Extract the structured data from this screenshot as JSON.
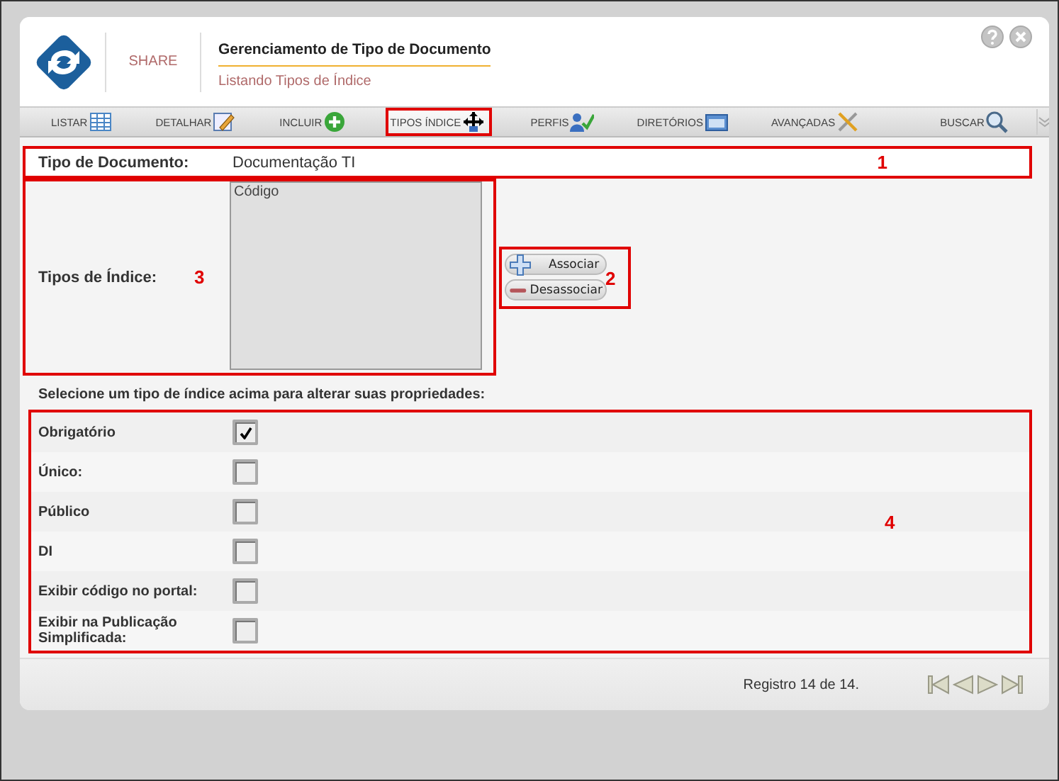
{
  "header": {
    "logo_text": "SHARE",
    "title": "Gerenciamento de Tipo de Documento",
    "subtitle": "Listando Tipos de Índice"
  },
  "tabs": [
    {
      "label": "LISTAR",
      "selected": false,
      "highlighted": false
    },
    {
      "label": "DETALHAR",
      "selected": false,
      "highlighted": false
    },
    {
      "label": "INCLUIR",
      "selected": false,
      "highlighted": false
    },
    {
      "label": "TIPOS ÍNDICE",
      "selected": true,
      "highlighted": true
    },
    {
      "label": "PERFIS",
      "selected": false,
      "highlighted": false
    },
    {
      "label": "DIRETÓRIOS",
      "selected": false,
      "highlighted": false
    },
    {
      "label": "AVANÇADAS",
      "selected": false,
      "highlighted": false
    }
  ],
  "search_label": "BUSCAR",
  "document_type": {
    "label": "Tipo de Documento:",
    "value": "Documentação TI",
    "annotation": "1"
  },
  "index_types": {
    "label": "Tipos de Índice:",
    "annotation": "3",
    "items": [
      {
        "label": "Código",
        "selected": false
      }
    ],
    "buttons": [
      {
        "kind": "add",
        "label": "Associar"
      },
      {
        "kind": "remove",
        "label": "Desassociar"
      }
    ],
    "buttons_annotation": "2"
  },
  "instruction": "Selecione um tipo de índice acima para alterar suas propriedades:",
  "properties": {
    "annotation": "4",
    "items": [
      {
        "label": "Obrigatório",
        "checked": true
      },
      {
        "label": "Único:",
        "checked": false
      },
      {
        "label": "Público",
        "checked": false
      },
      {
        "label": "DI",
        "checked": false
      },
      {
        "label": "Exibir código no portal:",
        "checked": false
      },
      {
        "label": "Exibir na Publicação Simplificada:",
        "checked": false
      }
    ]
  },
  "footer": {
    "record_text": "Registro 14 de 14."
  }
}
